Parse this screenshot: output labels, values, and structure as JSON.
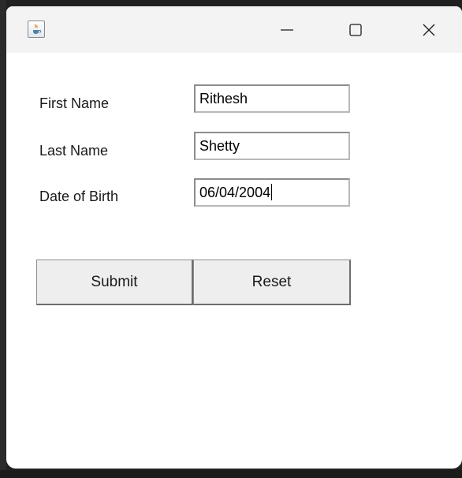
{
  "window": {
    "icon": "java-coffee-cup-icon",
    "controls": [
      "minimize-icon",
      "maximize-icon",
      "close-icon"
    ]
  },
  "form": {
    "first_name_label": "First Name",
    "first_name_value": "Rithesh",
    "last_name_label": "Last Name",
    "last_name_value": "Shetty",
    "dob_label": "Date of Birth",
    "dob_value": "06/04/2004"
  },
  "buttons": {
    "submit_label": "Submit",
    "reset_label": "Reset"
  }
}
